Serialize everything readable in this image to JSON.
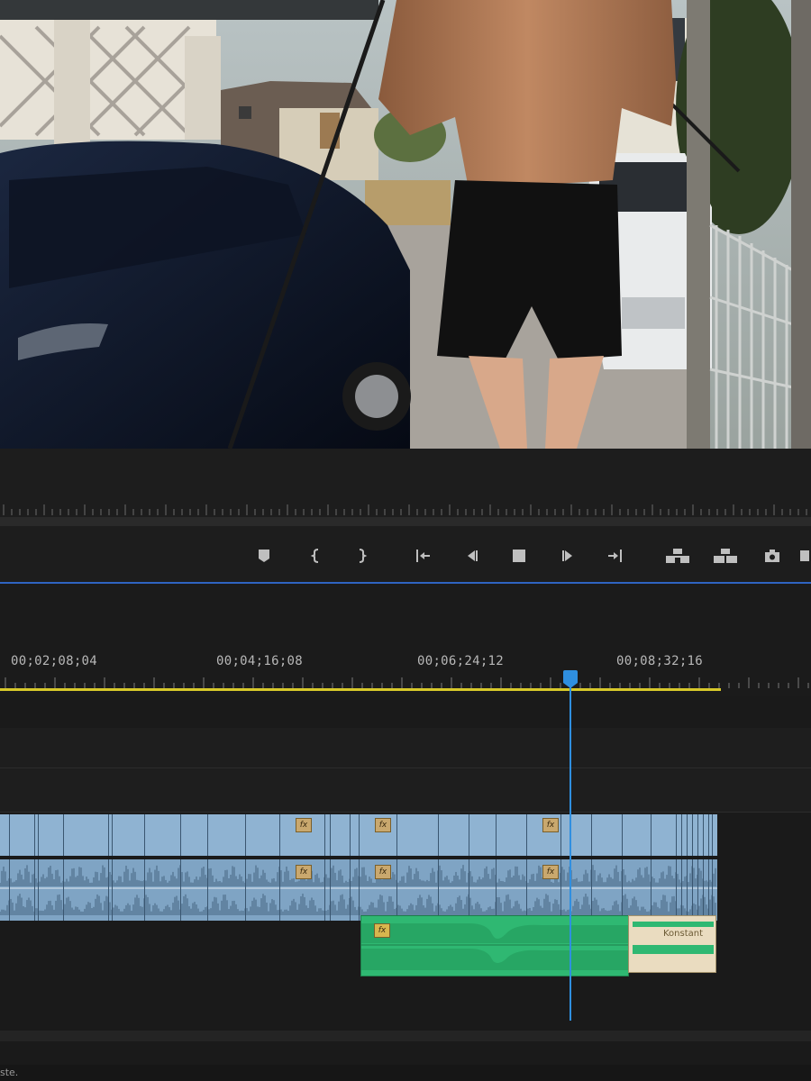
{
  "program_monitor": {
    "transport_icons": [
      "add-marker-icon",
      "mark-in-icon",
      "mark-out-icon",
      "go-to-in-icon",
      "step-back-icon",
      "stop-icon",
      "step-forward-icon",
      "go-to-out-icon",
      "lift-icon",
      "extract-icon",
      "export-frame-icon"
    ]
  },
  "timeline": {
    "timecodes": [
      "00;02;08;04",
      "00;04;16;08",
      "00;06;24;12",
      "00;08;32;16"
    ],
    "fx_label": "fx",
    "transition_label": "Konstant",
    "colors": {
      "work_area": "#d7c82a",
      "playhead": "#2f8fe0",
      "video_clip": "#8fb3d2",
      "audio_clip": "#7fa4c4",
      "music_clip": "#2fb872",
      "transition": "#eadcc0"
    }
  },
  "status_bar": {
    "text": "ste."
  }
}
